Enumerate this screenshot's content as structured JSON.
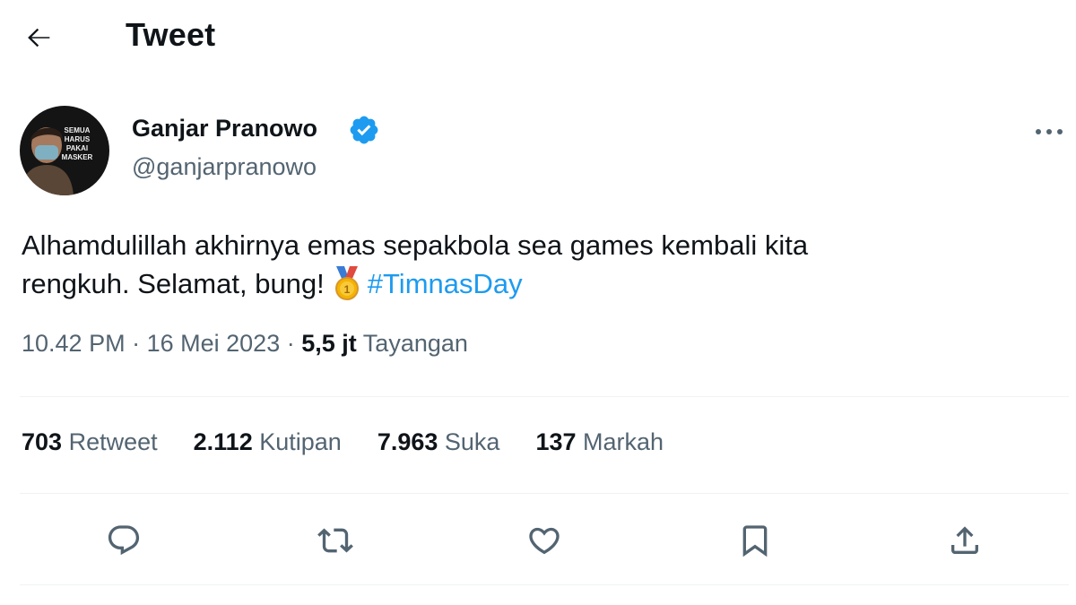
{
  "header": {
    "title": "Tweet",
    "back_icon": "arrow-left-icon"
  },
  "author": {
    "name": "Ganjar Pranowo",
    "handle": "@ganjarpranowo",
    "verified": true,
    "verified_color": "#1d9bf0",
    "avatar_poster_text": [
      "SEMUA",
      "HARUS",
      "PAKAI",
      "MASKER"
    ]
  },
  "tweet": {
    "text_line1": "Alhamdulillah akhirnya emas sepakbola sea games kembali kita",
    "text_line2": "rengkuh. Selamat, bung!",
    "emoji": "1st-place-medal",
    "hashtag": "#TimnasDay",
    "hashtag_color": "#1d9bf0"
  },
  "meta": {
    "time": "10.42 PM",
    "separator": "·",
    "date": "16 Mei 2023",
    "views_count": "5,5 jt",
    "views_label": "Tayangan"
  },
  "stats": [
    {
      "count": "703",
      "label": "Retweet"
    },
    {
      "count": "2.112",
      "label": "Kutipan"
    },
    {
      "count": "7.963",
      "label": "Suka"
    },
    {
      "count": "137",
      "label": "Markah"
    }
  ],
  "actions": [
    {
      "name": "reply",
      "icon": "reply-icon"
    },
    {
      "name": "retweet",
      "icon": "retweet-icon"
    },
    {
      "name": "like",
      "icon": "heart-icon"
    },
    {
      "name": "bookmark",
      "icon": "bookmark-icon"
    },
    {
      "name": "share",
      "icon": "share-icon"
    }
  ],
  "colors": {
    "text_primary": "#0f1419",
    "text_secondary": "#536471",
    "divider": "#eff3f4",
    "accent": "#1d9bf0"
  }
}
